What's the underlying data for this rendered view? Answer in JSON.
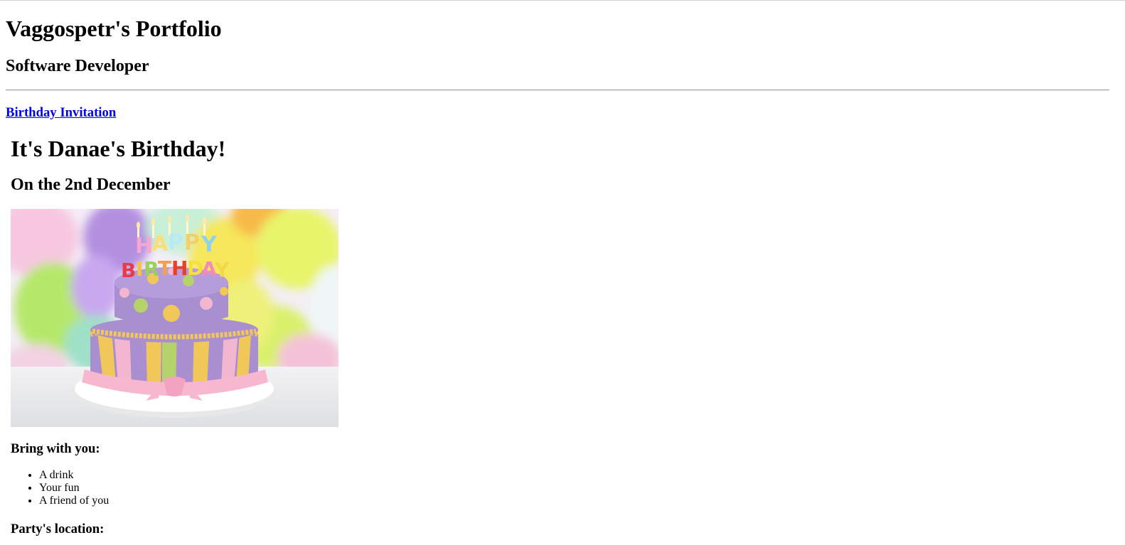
{
  "header": {
    "title": "Vaggospetr's Portfolio",
    "subtitle": "Software Developer"
  },
  "projects": {
    "link_label": "Birthday Invitation"
  },
  "invitation": {
    "title": "It's Danae's Birthday!",
    "date": "On the 2nd December",
    "image": {
      "icon": "birthday-cake-photo",
      "cake_candles_text": "HAPPY BIRTHDAY",
      "colors": {
        "cake_top": "#a88fcf",
        "stripe_pink": "#f2b6d0",
        "stripe_purple": "#a98fd0",
        "stripe_green": "#b6d36b",
        "stripe_yellow": "#f2c75a",
        "ribbon": "#f6b7cf",
        "balloon_yellow": "#e8f46b",
        "balloon_purple": "#b48fe0",
        "balloon_green": "#b5e86a"
      }
    },
    "bring_heading": "Bring with you:",
    "bring_items": [
      "A drink",
      "Your fun",
      "A friend of you"
    ],
    "location_heading": "Party's location:"
  }
}
